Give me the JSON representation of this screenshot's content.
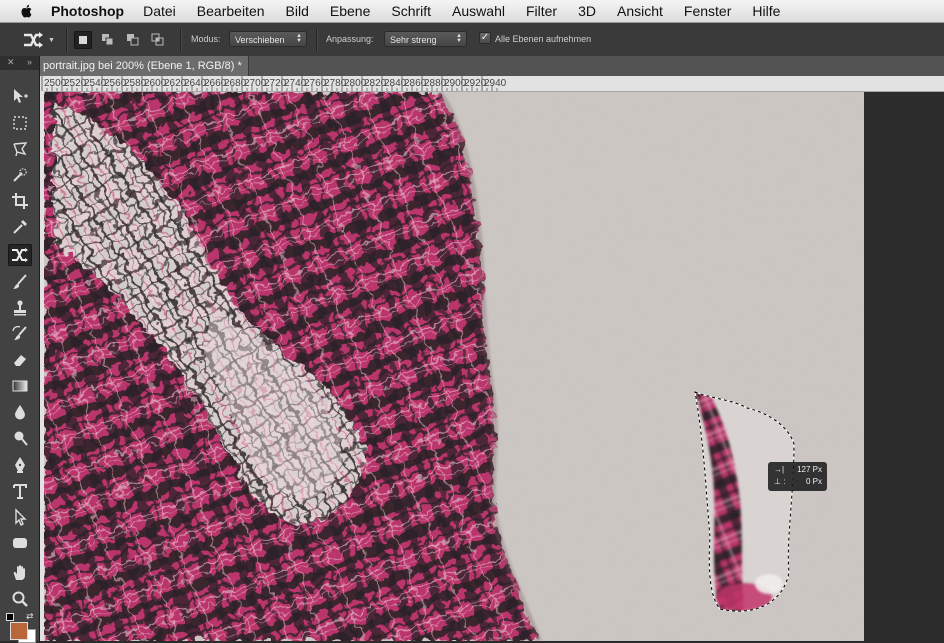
{
  "menubar": {
    "app_name": "Photoshop",
    "items": [
      "Datei",
      "Bearbeiten",
      "Bild",
      "Ebene",
      "Schrift",
      "Auswahl",
      "Filter",
      "3D",
      "Ansicht",
      "Fenster",
      "Hilfe"
    ]
  },
  "options_bar": {
    "mode_label": "Modus:",
    "mode_value": "Verschieben",
    "adaptation_label": "Anpassung:",
    "adaptation_value": "Sehr streng",
    "sample_all_layers_label": "Alle Ebenen aufnehmen",
    "sample_all_layers_checked": true,
    "selection_mode_active": "new-selection"
  },
  "document": {
    "tab_title": "portrait.jpg bei 200% (Ebene 1, RGB/8) *"
  },
  "ruler": {
    "labels": [
      "2500",
      "2520",
      "2540",
      "2560",
      "2580",
      "2600",
      "2620",
      "2640",
      "2660",
      "2680",
      "2700",
      "2720",
      "2740",
      "2760",
      "2780",
      "2800",
      "2820",
      "2840",
      "2860",
      "2880",
      "2900",
      "2920",
      "2940"
    ]
  },
  "toolbox": {
    "active_tool": "content-aware-move-tool",
    "foreground_color": "#b8663a",
    "background_color": "#ffffff"
  },
  "hud": {
    "dx_value": "127 Px",
    "dy_value": "0 Px"
  },
  "colors": {
    "fabric_pink": "#c2346b",
    "fabric_dark": "#2a2326",
    "background_wall": "#cdc7c4"
  }
}
